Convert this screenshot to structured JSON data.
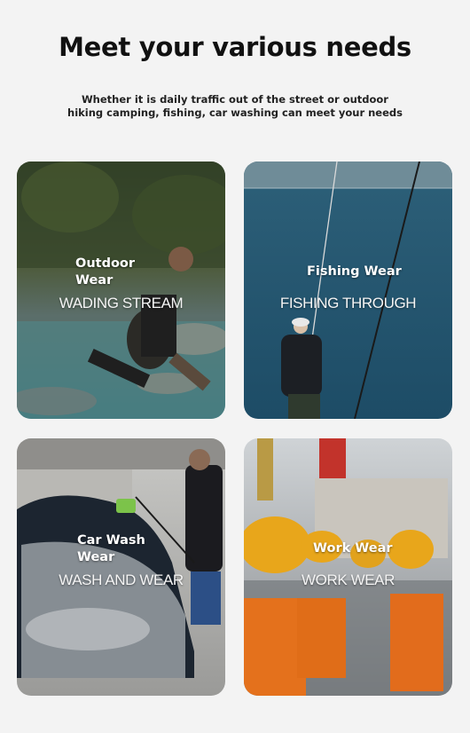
{
  "header": {
    "title": "Meet your various needs",
    "subtitle_line1": "Whether it is daily traffic out of the street or outdoor",
    "subtitle_line2": "hiking camping, fishing, car washing can meet your needs"
  },
  "cards": [
    {
      "label_line1": "Outdoor",
      "label_line2": "Wear",
      "caption": "WADING STREAM"
    },
    {
      "label_line1": "Fishing Wear",
      "caption": "FISHING THROUGH"
    },
    {
      "label_line1": "Car Wash",
      "label_line2": "Wear",
      "caption": "WASH AND WEAR"
    },
    {
      "label_line1": "Work Wear",
      "caption": "WORK WEAR"
    }
  ]
}
